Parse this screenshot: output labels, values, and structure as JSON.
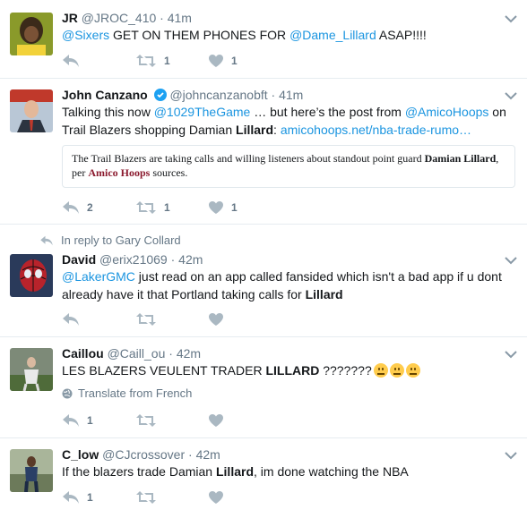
{
  "tweets": [
    {
      "name": "JR",
      "handle": "@JROC_410",
      "time": "41m",
      "text_parts": [
        "@Sixers",
        " GET ON THEM PHONES FOR ",
        "@Dame_Lillard",
        " ASAP!!!!"
      ],
      "retweets": "1",
      "likes": "1"
    },
    {
      "name": "John Canzano",
      "handle": "@johncanzanobft",
      "time": "41m",
      "text_parts": [
        "Talking this now ",
        "@1029TheGame",
        " … but here’s the post from ",
        "@AmicoHoops",
        " on",
        "Trail Blazers shopping Damian ",
        "Lillard",
        ": ",
        "amicohoops.net/nba-trade-rumo…"
      ],
      "card_parts": [
        "The Trail Blazers are taking calls and willing listeners about standout point guard ",
        "Damian Lillard",
        ",",
        "per ",
        "Amico Hoops",
        " sources."
      ],
      "replies": "2",
      "retweets": "1",
      "likes": "1"
    },
    {
      "reply_context": "In reply to Gary Collard",
      "name": "David",
      "handle": "@erix21069",
      "time": "42m",
      "text_parts": [
        "@LakerGMC",
        " just read on an app called fansided which isn't a bad app if u dont",
        "already have it that Portland taking calls for ",
        "Lillard"
      ]
    },
    {
      "name": "Caillou",
      "handle": "@Caill_ou",
      "time": "42m",
      "text_parts": [
        "LES BLAZERS VEULENT TRADER ",
        "LILLARD",
        " ???????"
      ],
      "translate": "Translate from French",
      "replies": "1"
    },
    {
      "name": "C_low",
      "handle": "@CJcrossover",
      "time": "42m",
      "text_parts": [
        "If the blazers trade Damian ",
        "Lillard",
        ", im done watching the NBA"
      ],
      "replies": "1"
    }
  ],
  "colors": {
    "link": "#1b95e0",
    "secondary": "#657786",
    "border": "#e6ecf0",
    "verified": "#1da1f2"
  },
  "icons": [
    "reply-icon",
    "retweet-icon",
    "like-icon",
    "chevron-down-icon",
    "verified-icon",
    "globe-icon",
    "reply-context-icon",
    "emoji-worried-icon"
  ]
}
